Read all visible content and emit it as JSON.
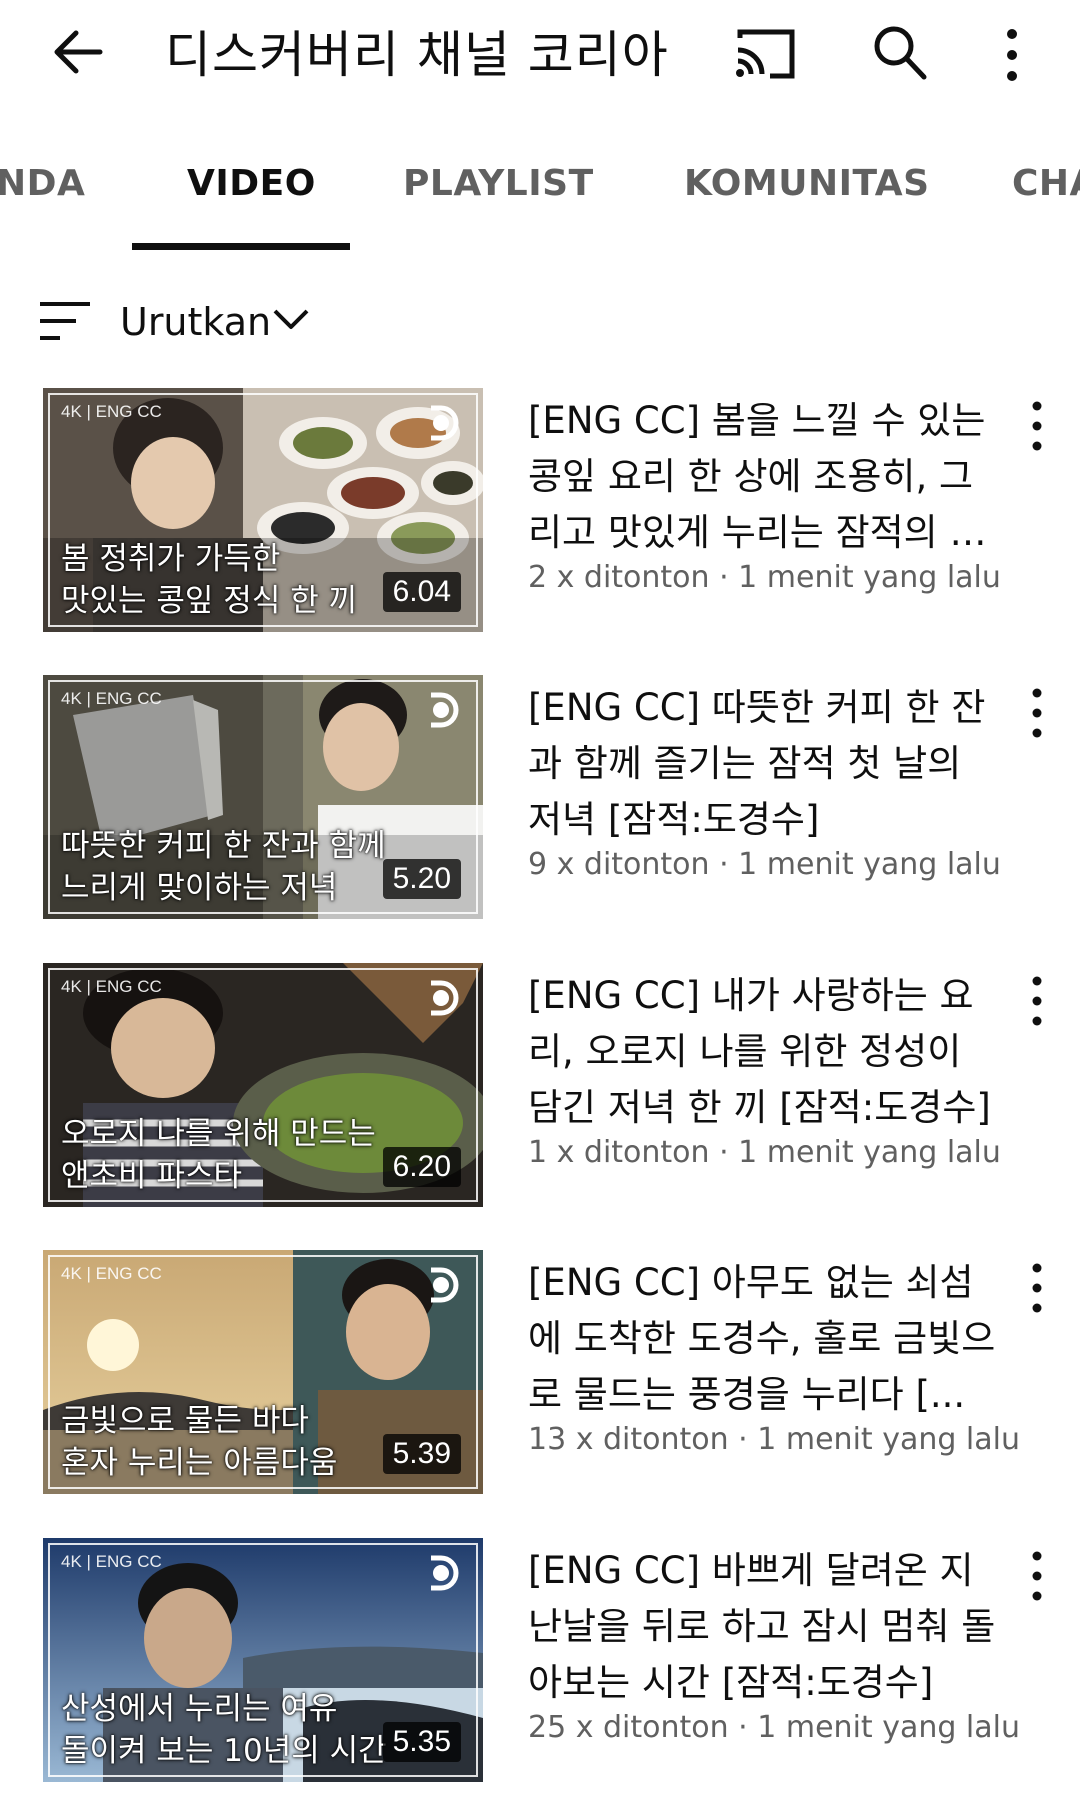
{
  "header": {
    "title": "디스커버리 채널 코리아",
    "icons": [
      "back-arrow-icon",
      "cast-icon",
      "search-icon",
      "more-vert-icon"
    ]
  },
  "tabs": [
    {
      "label": "NDA",
      "active": false
    },
    {
      "label": "VIDEO",
      "active": true
    },
    {
      "label": "PLAYLIST",
      "active": false
    },
    {
      "label": "KOMUNITAS",
      "active": false
    },
    {
      "label": "CHA",
      "active": false
    }
  ],
  "sort": {
    "label": "Urutkan"
  },
  "videos": [
    {
      "thumb_tag": "4K | ENG CC",
      "thumb_caption": "봄 정취가 가득한\n맛있는 콩잎 정식 한 끼",
      "duration": "6.04",
      "title": "[ENG CC] 봄을 느낄 수 있는 콩잎 요리 한 상에 조용히, 그리고 맛있게 누리는 잠적의 …",
      "meta": "2 x ditonton · 1 menit yang lalu"
    },
    {
      "thumb_tag": "4K | ENG CC",
      "thumb_caption": "따뜻한 커피 한 잔과 함께\n느리게 맞이하는 저녁",
      "duration": "5.20",
      "title": "[ENG CC] 따뜻한 커피 한 잔과 함께 즐기는 잠적 첫 날의 저녁 [잠적:도경수]",
      "meta": "9 x ditonton · 1 menit yang lalu"
    },
    {
      "thumb_tag": "4K | ENG CC",
      "thumb_caption": "오로지 나를 위해 만드는\n앤초비 파스타",
      "duration": "6.20",
      "title": "[ENG CC] 내가 사랑하는 요리, 오로지 나를 위한 정성이 담긴 저녁 한 끼 [잠적:도경수]",
      "meta": "1 x ditonton · 1 menit yang lalu"
    },
    {
      "thumb_tag": "4K | ENG CC",
      "thumb_caption": "금빛으로 물든 바다\n혼자 누리는 아름다움",
      "duration": "5.39",
      "title": "[ENG CC] 아무도 없는 쇠섬에 도착한 도경수, 홀로 금빛으로 물드는 풍경을 누리다 [...",
      "meta": "13 x ditonton · 1 menit yang lalu"
    },
    {
      "thumb_tag": "4K | ENG CC",
      "thumb_caption": "산성에서 누리는 여유\n돌이켜 보는 10년의 시간",
      "duration": "5.35",
      "title": "[ENG CC] 바쁘게 달려온 지난날을 뒤로 하고 잠시 멈춰 돌아보는 시간 [잠적:도경수]",
      "meta": "25 x ditonton · 1 menit yang lalu"
    }
  ],
  "colors": {
    "text": "#0f0f0f",
    "secondary": "#606060",
    "background": "#ffffff"
  }
}
